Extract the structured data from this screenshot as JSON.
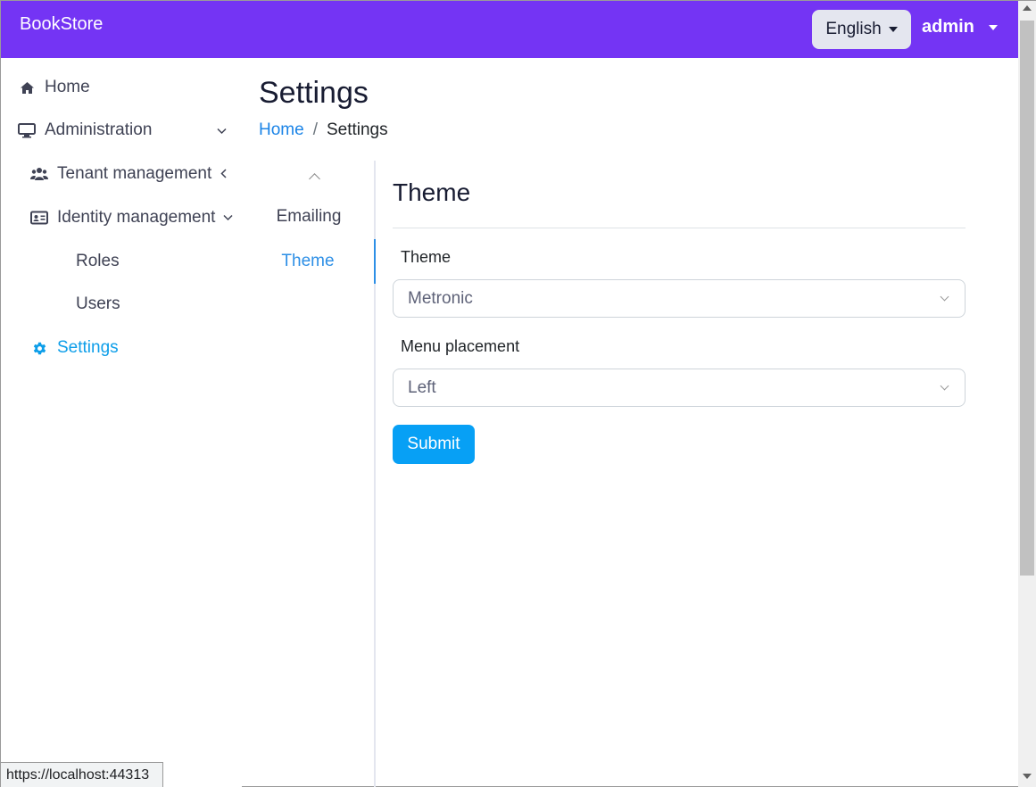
{
  "topbar": {
    "brand": "BookStore",
    "language": "English",
    "user": "admin",
    "background_color": "#7434f4"
  },
  "sidebar": {
    "items": [
      {
        "label": "Home",
        "icon": "home-icon"
      },
      {
        "label": "Administration",
        "icon": "monitor-icon",
        "expanded": true
      },
      {
        "label": "Tenant management",
        "icon": "users-icon",
        "expanded": false
      },
      {
        "label": "Identity management",
        "icon": "id-card-icon",
        "expanded": true
      },
      {
        "label": "Roles"
      },
      {
        "label": "Users"
      },
      {
        "label": "Settings",
        "icon": "gear-icon",
        "active": true
      }
    ]
  },
  "page": {
    "title": "Settings",
    "breadcrumb": {
      "home": "Home",
      "separator": "/",
      "current": "Settings"
    }
  },
  "tabs": {
    "items": [
      {
        "label": "Emailing",
        "active": false
      },
      {
        "label": "Theme",
        "active": true
      }
    ]
  },
  "form": {
    "section_title": "Theme",
    "theme_label": "Theme",
    "theme_value": "Metronic",
    "menu_label": "Menu placement",
    "menu_value": "Left",
    "submit_label": "Submit"
  },
  "status_bar": {
    "url": "https://localhost:44313"
  },
  "colors": {
    "accent": "#07a0f5",
    "link": "#1b84e7",
    "active_nav": "#0d9ee9"
  }
}
